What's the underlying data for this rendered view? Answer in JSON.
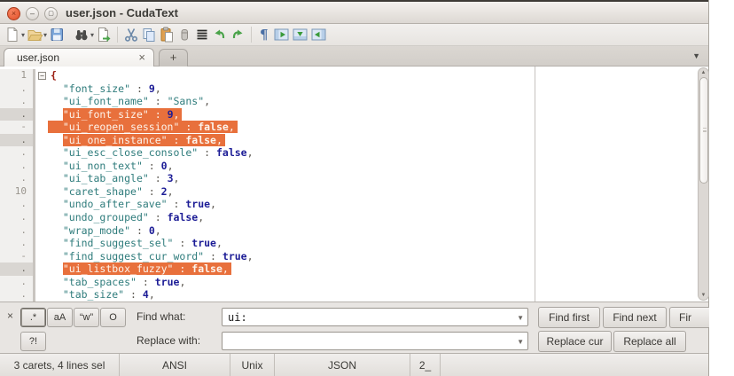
{
  "window": {
    "title": "user.json - CudaText"
  },
  "colors": {
    "selection": "#e8703c",
    "string": "#2f7c7c",
    "number": "#1c1c96",
    "accent_orange": "#e05029"
  },
  "toolbar": {
    "icons": [
      "new-file-icon",
      "open-file-icon",
      "save-icon",
      "find-icon",
      "save-as-icon",
      "cut-icon",
      "copy-icon",
      "paste-icon",
      "delete-icon",
      "select-all-icon",
      "undo-icon",
      "redo-icon",
      "show-invisibles-icon",
      "toggle-side-panel-icon",
      "toggle-bottom-panel-icon",
      "toggle-right-panel-icon"
    ]
  },
  "tabs": {
    "active_label": "user.json",
    "close_glyph": "×",
    "new_tab_label": "+",
    "min_glyph": "–",
    "max_glyph": "▢"
  },
  "editor": {
    "lines": [
      {
        "g": "1",
        "fold": true,
        "sel": null,
        "caret": false,
        "tokens": [
          [
            "{",
            "brace"
          ]
        ]
      },
      {
        "g": ".",
        "fold": false,
        "sel": null,
        "caret": false,
        "tokens": [
          [
            "\"font_size\"",
            "str"
          ],
          [
            " : ",
            "punct"
          ],
          [
            "9",
            "num"
          ],
          [
            ",",
            "punct"
          ]
        ]
      },
      {
        "g": ".",
        "fold": false,
        "sel": null,
        "caret": false,
        "tokens": [
          [
            "\"ui_font_name\"",
            "str"
          ],
          [
            " : ",
            "punct"
          ],
          [
            "\"Sans\"",
            "str"
          ],
          [
            ",",
            "punct"
          ]
        ]
      },
      {
        "g": ".",
        "fold": false,
        "sel": "text",
        "caret": true,
        "tokens": [
          [
            "\"ui_font_size\"",
            "str"
          ],
          [
            " : ",
            "punct"
          ],
          [
            "9",
            "num"
          ],
          [
            ",",
            "punct"
          ]
        ]
      },
      {
        "g": "-",
        "fold": false,
        "sel": "full",
        "caret": false,
        "tokens": [
          [
            "\"ui_reopen_session\"",
            "str"
          ],
          [
            " : ",
            "punct"
          ],
          [
            "false",
            "bool"
          ],
          [
            ",",
            "punct"
          ]
        ]
      },
      {
        "g": ".",
        "fold": false,
        "sel": "text",
        "caret": true,
        "tokens": [
          [
            "\"ui_one_instance\"",
            "str"
          ],
          [
            " : ",
            "punct"
          ],
          [
            "false",
            "bool"
          ],
          [
            ",",
            "punct"
          ]
        ]
      },
      {
        "g": ".",
        "fold": false,
        "sel": null,
        "caret": false,
        "tokens": [
          [
            "\"ui_esc_close_console\"",
            "str"
          ],
          [
            " : ",
            "punct"
          ],
          [
            "false",
            "bool"
          ],
          [
            ",",
            "punct"
          ]
        ]
      },
      {
        "g": ".",
        "fold": false,
        "sel": null,
        "caret": false,
        "tokens": [
          [
            "\"ui_non_text\"",
            "str"
          ],
          [
            " : ",
            "punct"
          ],
          [
            "0",
            "num"
          ],
          [
            ",",
            "punct"
          ]
        ]
      },
      {
        "g": ".",
        "fold": false,
        "sel": null,
        "caret": false,
        "tokens": [
          [
            "\"ui_tab_angle\"",
            "str"
          ],
          [
            " : ",
            "punct"
          ],
          [
            "3",
            "num"
          ],
          [
            ",",
            "punct"
          ]
        ]
      },
      {
        "g": "10",
        "fold": false,
        "sel": null,
        "caret": false,
        "tokens": [
          [
            "\"caret_shape\"",
            "str"
          ],
          [
            " : ",
            "punct"
          ],
          [
            "2",
            "num"
          ],
          [
            ",",
            "punct"
          ]
        ]
      },
      {
        "g": ".",
        "fold": false,
        "sel": null,
        "caret": false,
        "tokens": [
          [
            "\"undo_after_save\"",
            "str"
          ],
          [
            " : ",
            "punct"
          ],
          [
            "true",
            "bool"
          ],
          [
            ",",
            "punct"
          ]
        ]
      },
      {
        "g": ".",
        "fold": false,
        "sel": null,
        "caret": false,
        "tokens": [
          [
            "\"undo_grouped\"",
            "str"
          ],
          [
            " : ",
            "punct"
          ],
          [
            "false",
            "bool"
          ],
          [
            ",",
            "punct"
          ]
        ]
      },
      {
        "g": ".",
        "fold": false,
        "sel": null,
        "caret": false,
        "tokens": [
          [
            "\"wrap_mode\"",
            "str"
          ],
          [
            " : ",
            "punct"
          ],
          [
            "0",
            "num"
          ],
          [
            ",",
            "punct"
          ]
        ]
      },
      {
        "g": ".",
        "fold": false,
        "sel": null,
        "caret": false,
        "tokens": [
          [
            "\"find_suggest_sel\"",
            "str"
          ],
          [
            " : ",
            "punct"
          ],
          [
            "true",
            "bool"
          ],
          [
            ",",
            "punct"
          ]
        ]
      },
      {
        "g": "-",
        "fold": false,
        "sel": null,
        "caret": false,
        "tokens": [
          [
            "\"find_suggest_cur_word\"",
            "str"
          ],
          [
            " : ",
            "punct"
          ],
          [
            "true",
            "bool"
          ],
          [
            ",",
            "punct"
          ]
        ]
      },
      {
        "g": ".",
        "fold": false,
        "sel": "text",
        "caret": true,
        "tokens": [
          [
            "\"ui_listbox_fuzzy\"",
            "str"
          ],
          [
            " : ",
            "punct"
          ],
          [
            "false",
            "bool"
          ],
          [
            ",",
            "punct"
          ]
        ]
      },
      {
        "g": ".",
        "fold": false,
        "sel": null,
        "caret": false,
        "tokens": [
          [
            "\"tab_spaces\"",
            "str"
          ],
          [
            " : ",
            "punct"
          ],
          [
            "true",
            "bool"
          ],
          [
            ",",
            "punct"
          ]
        ]
      },
      {
        "g": ".",
        "fold": false,
        "sel": null,
        "caret": false,
        "tokens": [
          [
            "\"tab_size\"",
            "str"
          ],
          [
            " : ",
            "punct"
          ],
          [
            "4",
            "num"
          ],
          [
            ",",
            "punct"
          ]
        ]
      }
    ],
    "fold_glyph": "−",
    "indent": "  "
  },
  "find_panel": {
    "close_glyph": "×",
    "opts": [
      ".*",
      "aA",
      "“w”",
      "O"
    ],
    "opt_confirm": "?!",
    "find_label": "Find what:",
    "find_value": "ui:",
    "replace_label": "Replace with:",
    "replace_value": "",
    "btn_find_first": "Find first",
    "btn_find_next": "Find next",
    "btn_find_cut": "Fir",
    "btn_replace_cur": "Replace cur",
    "btn_replace_all": "Replace all",
    "combo_arrow": "▼"
  },
  "statusbar": {
    "cells": [
      "3 carets, 4 lines sel",
      "ANSI",
      "Unix",
      "JSON",
      "2_",
      ""
    ]
  }
}
